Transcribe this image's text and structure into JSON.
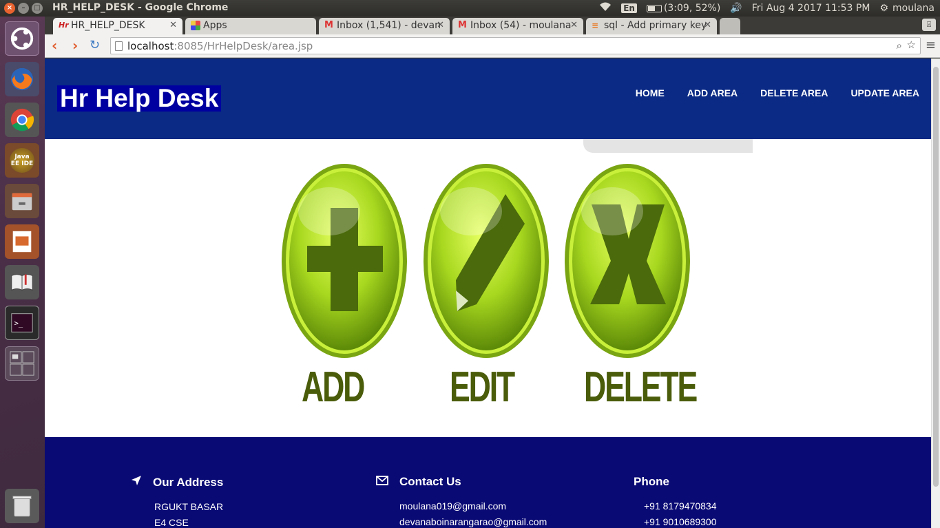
{
  "system": {
    "window_title": "HR_HELP_DESK - Google Chrome",
    "keyboard": "En",
    "battery": "(3:09, 52%)",
    "datetime": "Fri Aug  4 2017 11:53 PM",
    "user": "moulana"
  },
  "browser": {
    "tabs": [
      {
        "label": "HR_HELP_DESK",
        "active": true
      },
      {
        "label": "Apps",
        "active": false
      },
      {
        "label": "Inbox (1,541) - devan",
        "active": false
      },
      {
        "label": "Inbox (54) - moulana",
        "active": false
      },
      {
        "label": "sql - Add primary key",
        "active": false
      }
    ],
    "url_host": "localhost",
    "url_rest": ":8085/HrHelpDesk/area.jsp"
  },
  "launcher": {
    "items": [
      "ubuntu-dash",
      "firefox",
      "chrome",
      "java-ee-ide",
      "files",
      "impress",
      "reader",
      "terminal",
      "workspaces",
      "trash"
    ],
    "java_label": "Java EE IDE"
  },
  "site": {
    "logo": "Hr Help Desk",
    "nav": [
      "HOME",
      "ADD AREA",
      "DELETE AREA",
      "UPDATE AREA"
    ],
    "buttons": [
      "ADD",
      "EDIT",
      "DELETE"
    ],
    "footer": {
      "address": {
        "title": "Our Address",
        "lines": [
          "RGUKT BASAR",
          "E4 CSE"
        ]
      },
      "contact": {
        "title": "Contact Us",
        "lines": [
          "moulana019@gmail.com",
          "devanaboinarangarao@gmail.com"
        ]
      },
      "phone": {
        "title": "Phone",
        "lines": [
          "+91 8179470834",
          "+91 9010689300"
        ]
      }
    }
  },
  "colors": {
    "header": "#0a2a85",
    "footer": "#0a0a75",
    "button_green": "#9acd1a"
  }
}
